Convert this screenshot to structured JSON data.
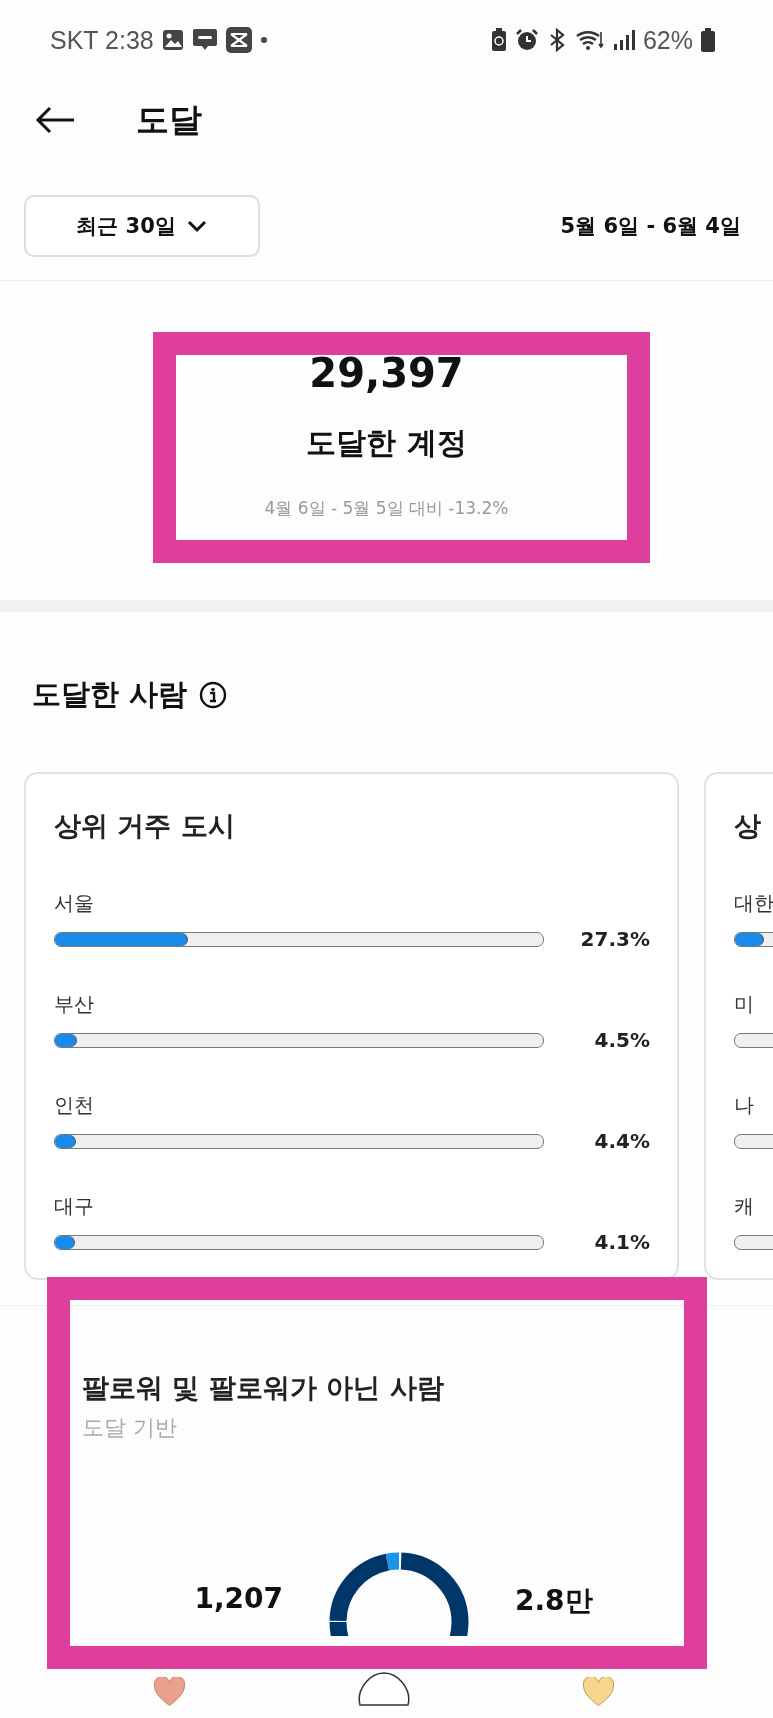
{
  "status_bar": {
    "carrier_time": "SKT 2:38",
    "battery": "62%"
  },
  "header": {
    "title": "도달"
  },
  "filter": {
    "period": "최근 30일",
    "range": "5월 6일 - 6월 4일"
  },
  "summary": {
    "value": "29,397",
    "label": "도달한 계정",
    "comparison": "4월 6일 - 5월 5일 대비 -13.2%",
    "highlighted": true
  },
  "audience": {
    "title": "도달한 사람",
    "cards": [
      {
        "title": "상위 거주 도시",
        "rows": [
          {
            "name": "서울",
            "level": 0.273,
            "reading": "27.3%"
          },
          {
            "name": "부산",
            "level": 0.045,
            "reading": "4.5%"
          },
          {
            "name": "인천",
            "level": 0.044,
            "reading": "4.4%"
          },
          {
            "name": "대구",
            "level": 0.041,
            "reading": "4.1%"
          }
        ]
      },
      {
        "title": "상",
        "rows": [
          {
            "name": "대한",
            "level": 0.06
          },
          {
            "name": "미"
          },
          {
            "name": "나"
          },
          {
            "name": "캐"
          }
        ]
      }
    ]
  },
  "followers": {
    "title": "팔로워 및 팔로워가 아닌 사람",
    "subtitle": "도달 기반",
    "followers_value": "1,207",
    "non_followers_value": "2.8만",
    "highlighted": true
  }
}
